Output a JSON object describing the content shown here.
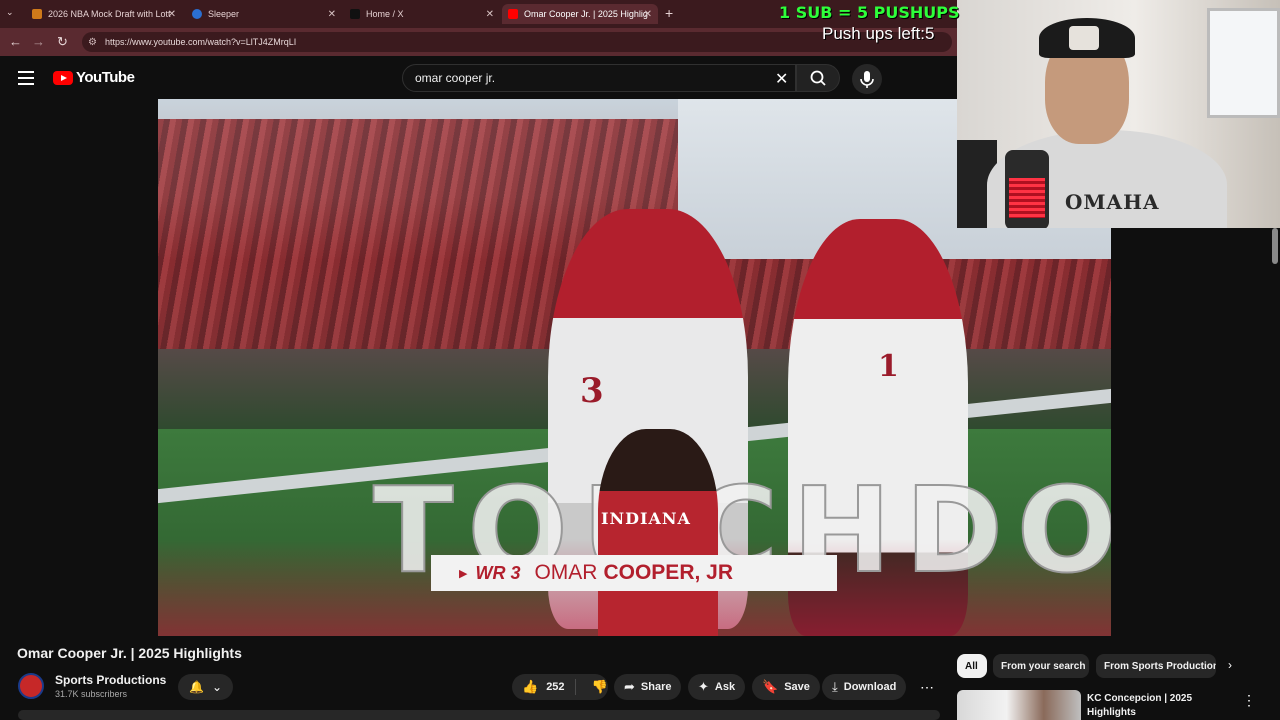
{
  "browser": {
    "tabs": [
      {
        "label": "2026 NBA Mock Draft with Lott",
        "favicon_color": "#d07a1a"
      },
      {
        "label": "Sleeper",
        "favicon_color": "#2b6fd1"
      },
      {
        "label": "Home / X",
        "favicon_color": "#111111"
      },
      {
        "label": "Omar Cooper Jr. | 2025 Highlig",
        "favicon_color": "#ff0000"
      }
    ],
    "close_glyph": "✕",
    "new_tab_glyph": "+",
    "tab_list_glyph": "⌄",
    "back_glyph": "←",
    "forward_glyph": "→",
    "reload_glyph": "↻",
    "siteinfo_glyph": "⚙",
    "url": "https://www.youtube.com/watch?v=LlTJ4ZMrqLI"
  },
  "youtube": {
    "logo_text": "YouTube",
    "search_value": "omar cooper jr.",
    "clear_glyph": "✕",
    "search_glyph": "⌕",
    "mic_glyph": "🎙"
  },
  "video_frame": {
    "jersey_left": "3",
    "jersey_right": "1",
    "touchdown": "TOUCHDOWN",
    "cutout_jersey": "INDIANA",
    "nameplate_arrow": "▶",
    "nameplate_pos": "WR 3",
    "nameplate_first": "OMAR",
    "nameplate_last": "COOPER, JR"
  },
  "stream_overlay": {
    "sub_rule": "1 SUB = 5 PUSHUPS",
    "pushups_left": "Push ups left:5",
    "shirt_text": "OMAHA"
  },
  "video_info": {
    "title": "Omar Cooper Jr. | 2025 Highlights",
    "channel_name": "Sports Productions",
    "subscribers": "31.7K subscribers",
    "bell_glyph": "🔔",
    "chevron_glyph": "⌄",
    "like_count": "252",
    "like_glyph": "👍",
    "dislike_glyph": "👎",
    "share_glyph": "➦",
    "share": "Share",
    "ask_glyph": "✦",
    "ask": "Ask",
    "save_glyph": "🔖",
    "save": "Save",
    "download_glyph": "⤓",
    "download": "Download",
    "more_glyph": "⋯"
  },
  "sidebar": {
    "chips": [
      "All",
      "From your search",
      "From Sports Productions"
    ],
    "next_glyph": "›",
    "recommendation_title": "KC Concepcion | 2025 Highlights",
    "rec_more_glyph": "⋮"
  }
}
